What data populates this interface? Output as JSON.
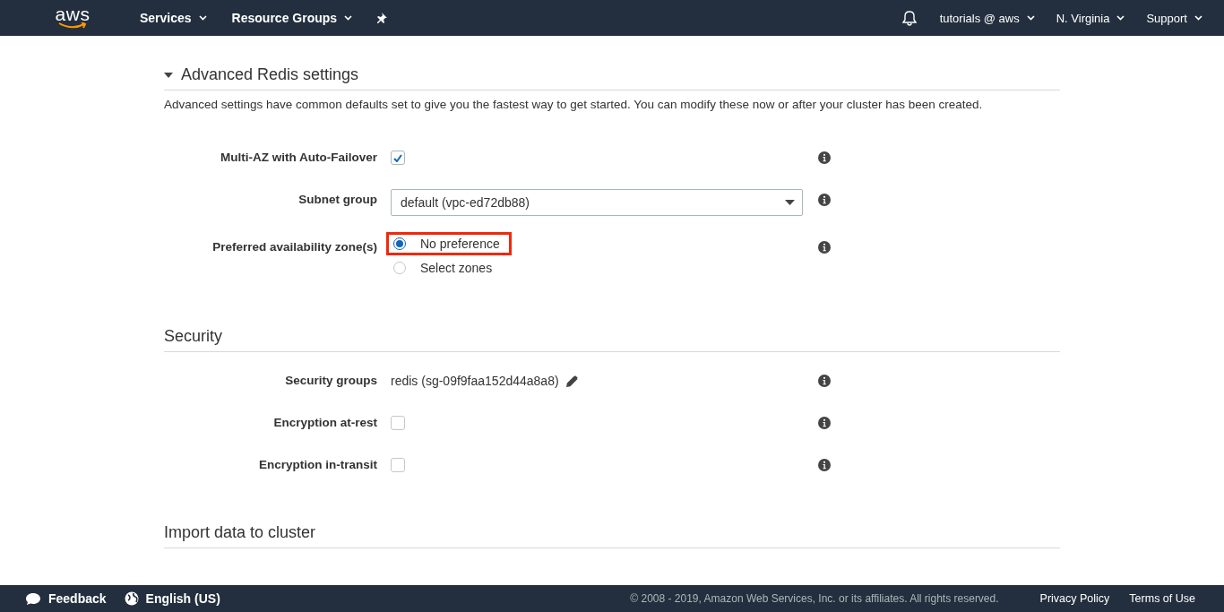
{
  "navbar": {
    "logo": "aws",
    "menus": [
      {
        "label": "Services"
      },
      {
        "label": "Resource Groups"
      }
    ],
    "right_menus": [
      {
        "label": "tutorials @ aws"
      },
      {
        "label": "N. Virginia"
      },
      {
        "label": "Support"
      }
    ]
  },
  "sections": [
    {
      "title": "Advanced Redis settings",
      "expanded": true,
      "description": "Advanced settings have common defaults set to give you the fastest way to get started. You can modify these now or after your cluster has been created.",
      "fields": [
        {
          "kind": "checkbox",
          "label": "Multi-AZ with Auto-Failover",
          "checked": true
        },
        {
          "kind": "select",
          "label": "Subnet group",
          "value": "default (vpc-ed72db88)"
        },
        {
          "kind": "radio",
          "label": "Preferred availability zone(s)",
          "options": [
            {
              "label": "No preference",
              "selected": true,
              "highlighted": true
            },
            {
              "label": "Select zones",
              "selected": false,
              "highlighted": false
            }
          ]
        }
      ]
    },
    {
      "title": "Security",
      "fields": [
        {
          "kind": "editable_text",
          "label": "Security groups",
          "value": "redis (sg-09f9faa152d44a8a8)"
        },
        {
          "kind": "checkbox",
          "label": "Encryption at-rest",
          "checked": false
        },
        {
          "kind": "checkbox",
          "label": "Encryption in-transit",
          "checked": false
        }
      ]
    },
    {
      "title": "Import data to cluster"
    }
  ],
  "footer": {
    "left": [
      {
        "kind": "feedback",
        "label": "Feedback"
      },
      {
        "kind": "language",
        "label": "English (US)"
      }
    ],
    "copyright": "© 2008 - 2019, Amazon Web Services, Inc. or its affiliates. All rights reserved.",
    "links": [
      "Privacy Policy",
      "Terms of Use"
    ]
  }
}
